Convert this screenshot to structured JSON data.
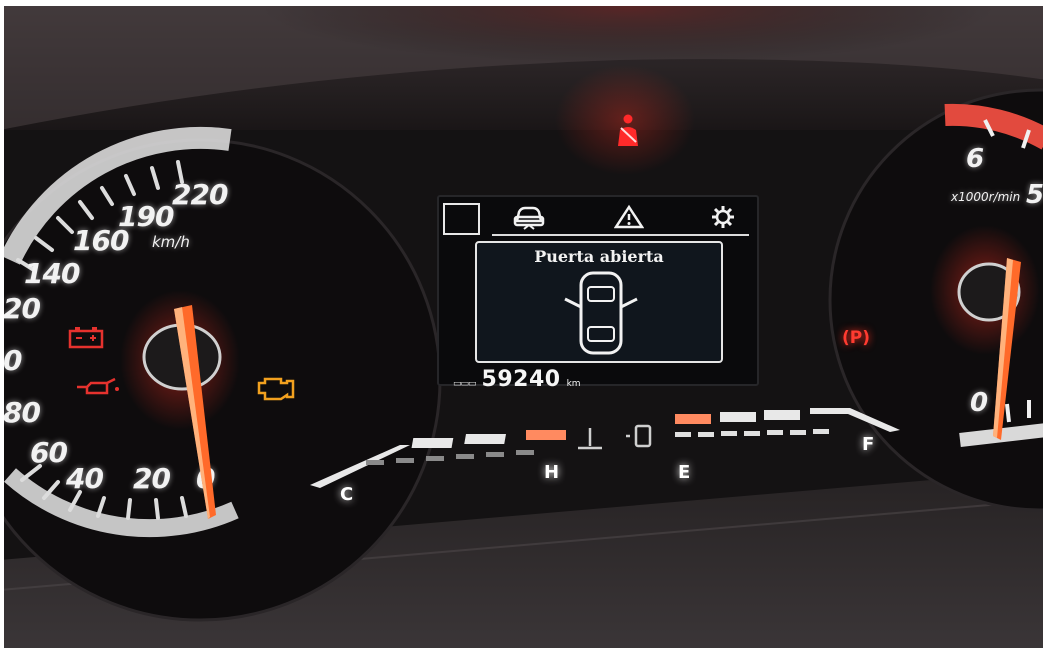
{
  "speedometer": {
    "unit": "km/h",
    "labels": [
      "220",
      "190",
      "160",
      "140",
      "20",
      "0",
      "80",
      "60",
      "40",
      "20",
      "0"
    ]
  },
  "display": {
    "message": "Puerta abierta",
    "odometer_value": "59240",
    "odometer_unit": "km"
  },
  "gauges": {
    "temp_cold": "C",
    "temp_hot": "H",
    "fuel_empty": "E",
    "fuel_full": "F"
  },
  "tachometer": {
    "label_6": "6",
    "unit": "x1000r/min",
    "label_5": "5",
    "label_0": "0"
  },
  "warning_lights": {
    "parking_brake": "(P)",
    "battery_color": "#e5322e",
    "oil_color": "#e5322e",
    "check_engine_color": "#f2a11f",
    "seatbelt_color": "#ff2a2a"
  },
  "colors": {
    "accent_red": "#ff3b30",
    "needle": "#ff6a2a",
    "display_bg": "#0a0a0c"
  }
}
